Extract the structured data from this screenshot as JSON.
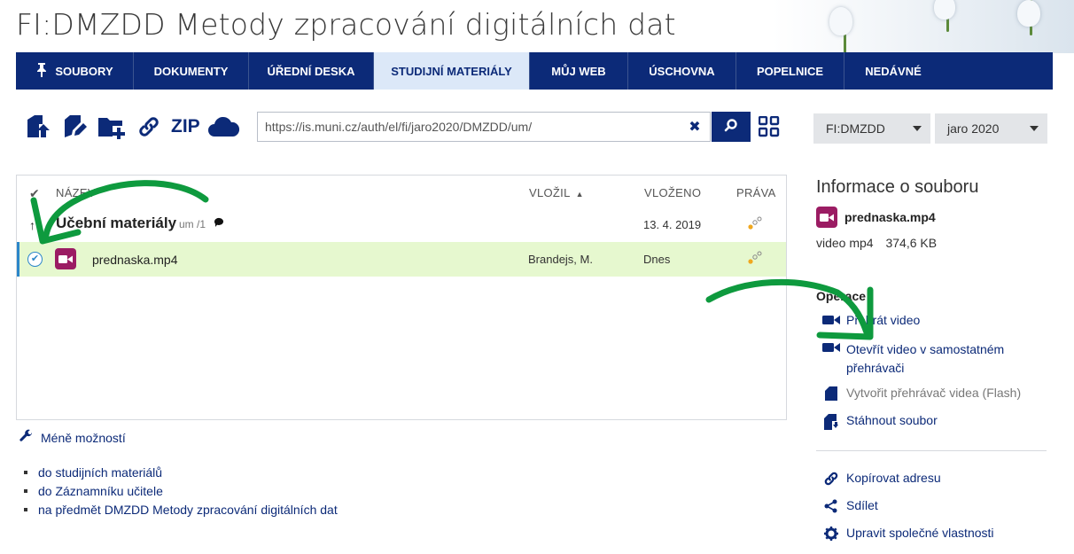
{
  "page": {
    "title": "FI:DMZDD Metody zpracování digitálních dat"
  },
  "nav": {
    "items": [
      {
        "label": "Soubory"
      },
      {
        "label": "Dokumenty"
      },
      {
        "label": "Úřední deska"
      },
      {
        "label": "Studijní materiály",
        "active": true
      },
      {
        "label": "Můj web"
      },
      {
        "label": "Úschovna"
      },
      {
        "label": "Popelnice"
      },
      {
        "label": "Nedávné"
      }
    ]
  },
  "toolbar": {
    "zip_label": "ZIP",
    "url_value": "https://is.muni.cz/auth/el/fi/jaro2020/DMZDD/um/",
    "clear_label": "✖",
    "icons": [
      "upload-file-icon",
      "edit-file-icon",
      "new-folder-icon",
      "link-icon",
      "cloud-icon",
      "search-icon",
      "grid-view-icon"
    ]
  },
  "selects": {
    "course": "FI:DMZDD",
    "term": "jaro 2020"
  },
  "file_list": {
    "headers": {
      "name": "Název",
      "author": "Vložil",
      "date": "Vloženo",
      "rights": "Práva"
    },
    "parent": {
      "name": "Učební materiály",
      "meta": "um /1",
      "date": "13. 4. 2019"
    },
    "rows": [
      {
        "name": "prednaska.mp4",
        "author": "Brandejs, M.",
        "date": "Dnes"
      }
    ]
  },
  "more_options": {
    "label": "Méně možností"
  },
  "bottom_links": [
    {
      "label": "do studijních materiálů"
    },
    {
      "label": "do Záznamníku učitele"
    },
    {
      "label": "na předmět DMZDD Metody zpracování digitálních dat"
    }
  ],
  "info": {
    "title": "Informace o souboru",
    "file_name": "prednaska.mp4",
    "file_type": "video mp4",
    "file_size": "374,6 KB",
    "operations_label": "Operace",
    "operations": [
      {
        "label": "Přehrát video"
      },
      {
        "label": "Otevřít video v samostatném přehrávači"
      },
      {
        "label": "Vytvořit přehrávač videa (Flash)"
      },
      {
        "label": "Stáhnout soubor"
      }
    ],
    "actions": [
      {
        "label": "Kopírovat adresu"
      },
      {
        "label": "Sdílet"
      },
      {
        "label": "Upravit společné vlastnosti"
      }
    ]
  },
  "colors": {
    "brand": "#0c2a78",
    "selected_row": "#e6f8cf",
    "annotation_arrow": "#0e9a3e",
    "video_icon": "#9b1c63"
  }
}
